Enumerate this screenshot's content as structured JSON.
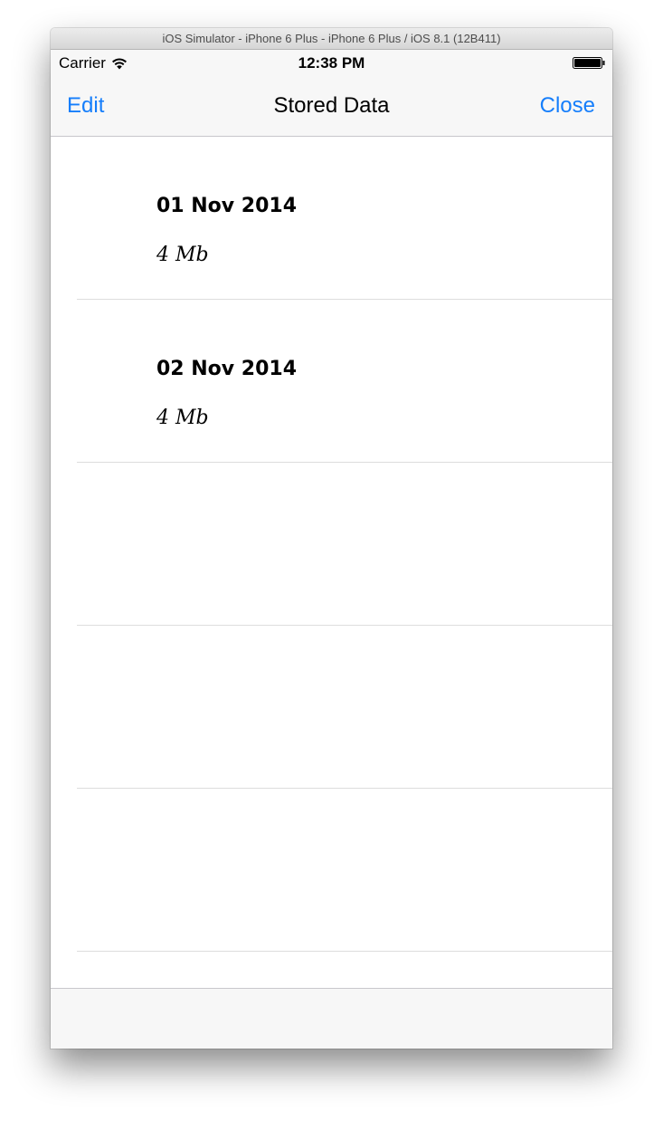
{
  "window": {
    "title": "iOS Simulator - iPhone 6 Plus - iPhone 6 Plus / iOS 8.1 (12B411)"
  },
  "status_bar": {
    "carrier": "Carrier",
    "time": "12:38 PM",
    "wifi_icon": "wifi-icon",
    "battery_icon": "battery-icon",
    "battery_level": 1.0
  },
  "nav_bar": {
    "left_button": "Edit",
    "title": "Stored Data",
    "right_button": "Close"
  },
  "table": {
    "rows": [
      {
        "date": "01 Nov 2014",
        "size": "4 Mb"
      },
      {
        "date": "02 Nov 2014",
        "size": "4 Mb"
      },
      {
        "date": "",
        "size": ""
      },
      {
        "date": "",
        "size": ""
      },
      {
        "date": "",
        "size": ""
      }
    ]
  },
  "colors": {
    "tint": "#157efb",
    "bar_background": "#f7f7f7",
    "separator": "#dddddd"
  }
}
